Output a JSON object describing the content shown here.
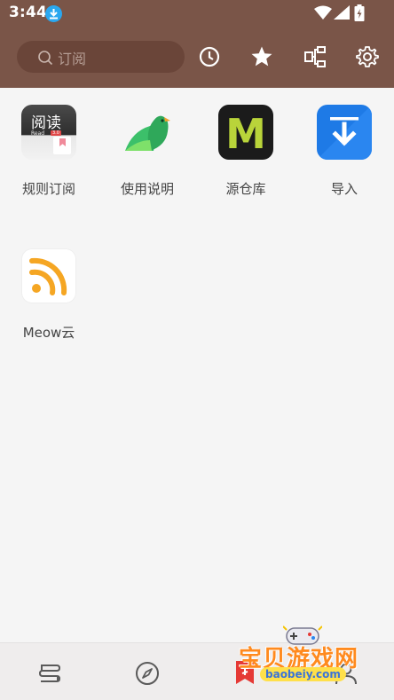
{
  "status_bar": {
    "time": "3:44"
  },
  "toolbar": {
    "search_placeholder": "订阅",
    "icons": [
      "history-icon",
      "star-icon",
      "group-icon",
      "settings-icon"
    ]
  },
  "sources": [
    {
      "label": "规则订阅",
      "icon": "rule-subscription-icon",
      "icon_text": "阅读",
      "icon_subtext": "Read",
      "icon_badge": "3.0"
    },
    {
      "label": "使用说明",
      "icon": "bird-icon"
    },
    {
      "label": "源仓库",
      "icon": "market-icon",
      "icon_text": "M"
    },
    {
      "label": "导入",
      "icon": "import-icon"
    },
    {
      "label": "Meow云",
      "icon": "rss-icon"
    }
  ],
  "bottom_nav": [
    "bookshelf-icon",
    "explore-icon",
    "rss-tab-icon",
    "profile-icon"
  ],
  "watermark": {
    "text": "宝贝游戏网",
    "url": "baobeiy.com"
  },
  "colors": {
    "header": "#7a5548",
    "search_bg": "#6a4539",
    "import_blue": "#1e7ae6",
    "rss_orange": "#f5a623"
  }
}
